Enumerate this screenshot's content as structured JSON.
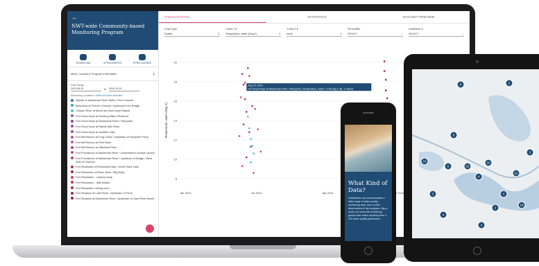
{
  "sidebar": {
    "back": "←",
    "title": "NWT-wide Community-based Monitoring Program",
    "tools": [
      {
        "label": "DOWNLOAD",
        "icon": "cloud-download-icon"
      },
      {
        "label": "ATTACHMENTS",
        "icon": "paperclip-icon"
      },
      {
        "label": "OPEN LICENSE",
        "icon": "license-icon"
      }
    ],
    "meta_label": "Meta, Contact & Program Information",
    "date_range_label": "Date Range",
    "date_from": "2012-08-31",
    "date_sep": "to",
    "date_to": "2019-10-10",
    "locations_label": "Monitoring Locations",
    "select_all": "Select all",
    "clear_selection": "Clear selection",
    "locations": [
      {
        "label": "Aklavik at Mackenzie River Delta / Peel Channel",
        "color": "#3a6fb0"
      },
      {
        "label": "Behchoko at Frank's Channel / Upstream from Bridge",
        "color": "#2aa8b8"
      },
      {
        "label": "Canyon River at Mouth by Sans Sault Rapids",
        "color": "#4cc0c0"
      },
      {
        "label": "Fort Good Hope at Drinking Water Reservoir",
        "color": "#7a5bb0"
      },
      {
        "label": "Fort Good Hope at Mackenzie River / Ramparts",
        "color": "#9a2f8f"
      },
      {
        "label": "Fort Good Hope at Rabbit Skin River",
        "color": "#b03a9a"
      },
      {
        "label": "Fort Good Hope at Jackfish Lake",
        "color": "#8a4fb5"
      },
      {
        "label": "Fort McPherson at Frog Creek / Upstream of Dempster Ferry",
        "color": "#c2459b"
      },
      {
        "label": "Fort McPherson at Peel River",
        "color": "#d14c95"
      },
      {
        "label": "Fort McPherson at Vittrekwa River",
        "color": "#c0398a"
      },
      {
        "label": "Fort Providence at Mackenzie River / Downstream of Boat Launch",
        "color": "#d6446b"
      },
      {
        "label": "Fort Providence at Mackenzie River / Upstream of Bridge / West Side of Channel",
        "color": "#c73363"
      },
      {
        "label": "Fort Resolution at Resolution Bay / Great Slave Lake",
        "color": "#b82456"
      },
      {
        "label": "Fort Resolution at Slave River / Big Eddy",
        "color": "#a81f4a"
      },
      {
        "label": "Fort Resolution - cultural camp",
        "color": "#d13c55"
      },
      {
        "label": "Fort Resolution - little buffalo",
        "color": "#c8304a"
      },
      {
        "label": "Fort Resolution mining zone",
        "color": "#b52a42"
      },
      {
        "label": "Fort Simpson at Liard River / Upstream of Ferry",
        "color": "#a3213a"
      },
      {
        "label": "Fort Simpson at Mackenzie River / Upstream of Liard River Mouth",
        "color": "#931b33"
      }
    ]
  },
  "tabs": [
    "VISUALIZATION",
    "STATISTICS",
    "DATASET PREVIEW"
  ],
  "controls": [
    {
      "label": "Chart Type",
      "value": "Scatter",
      "suffix": "⇕"
    },
    {
      "label": "Y-Axis 1 ●",
      "value": "Temperature, water (Deg C)",
      "suffix": "⇕"
    },
    {
      "label": "Y-Axis 2 ●",
      "value": "None",
      "suffix": "⇕"
    },
    {
      "label": "Percentiles",
      "value": "SELECT",
      "suffix": "⌄"
    },
    {
      "label": "Guidelines ●",
      "value": "SELECT",
      "suffix": "⌄"
    }
  ],
  "chart_data": {
    "type": "scatter",
    "ylabel": "Temperature, water (Deg C)",
    "yticks": [
      8,
      10,
      12,
      14,
      16,
      18,
      20
    ],
    "ylim": [
      7,
      21
    ],
    "xticks": [
      "Jan 2013",
      "Jul 2013",
      "Jan 2014",
      "Jul 2014"
    ],
    "tooltip": "Aug 23, 2013\nFort Good Hope at Mackenzie River / Ramparts | Temperature, water: 17.65 deg C @ -1 metres",
    "series": [
      {
        "color": "#8e2f9c",
        "values": [
          {
            "x": 0.45,
            "y": 17.7
          },
          {
            "x": 0.46,
            "y": 16.2
          },
          {
            "x": 0.47,
            "y": 14.9
          },
          {
            "x": 0.48,
            "y": 19.4
          },
          {
            "x": 0.49,
            "y": 12.8
          },
          {
            "x": 0.5,
            "y": 11.3
          },
          {
            "x": 0.44,
            "y": 18.8
          },
          {
            "x": 0.51,
            "y": 15.5
          },
          {
            "x": 0.47,
            "y": 10.2
          },
          {
            "x": 0.45,
            "y": 13.6
          }
        ]
      },
      {
        "color": "#4cc0c0",
        "values": [
          {
            "x": 0.49,
            "y": 13.2
          },
          {
            "x": 0.5,
            "y": 12.1
          },
          {
            "x": 0.51,
            "y": 11.4
          },
          {
            "x": 0.48,
            "y": 14.4
          },
          {
            "x": 0.52,
            "y": 10.6
          },
          {
            "x": 0.5,
            "y": 9.7
          }
        ]
      },
      {
        "color": "#d6446b",
        "values": [
          {
            "x": 0.43,
            "y": 16.4
          },
          {
            "x": 0.46,
            "y": 17.9
          },
          {
            "x": 0.49,
            "y": 18.6
          },
          {
            "x": 0.53,
            "y": 15.2
          },
          {
            "x": 0.55,
            "y": 13.1
          },
          {
            "x": 0.42,
            "y": 12.4
          },
          {
            "x": 0.57,
            "y": 10.8
          },
          {
            "x": 0.44,
            "y": 9.3
          },
          {
            "x": 0.52,
            "y": 8.6
          }
        ]
      },
      {
        "color": "#a81f3c",
        "values": [
          {
            "x": 1.44,
            "y": 20.1
          },
          {
            "x": 1.44,
            "y": 19.1
          },
          {
            "x": 1.45,
            "y": 18.2
          },
          {
            "x": 1.45,
            "y": 17.1
          },
          {
            "x": 1.46,
            "y": 16.3
          },
          {
            "x": 1.44,
            "y": 15.2
          },
          {
            "x": 1.45,
            "y": 14.1
          },
          {
            "x": 1.46,
            "y": 13.2
          },
          {
            "x": 1.44,
            "y": 12.1
          },
          {
            "x": 1.45,
            "y": 11.3
          },
          {
            "x": 1.46,
            "y": 10.2
          },
          {
            "x": 1.45,
            "y": 9.3
          },
          {
            "x": 1.44,
            "y": 8.4
          }
        ]
      },
      {
        "color": "#c2459b",
        "values": [
          {
            "x": 1.86,
            "y": 19.6
          },
          {
            "x": 1.87,
            "y": 18.4
          },
          {
            "x": 1.86,
            "y": 17.2
          },
          {
            "x": 1.88,
            "y": 16.1
          },
          {
            "x": 1.87,
            "y": 15.1
          }
        ]
      }
    ]
  },
  "phone": {
    "title": "What Kind of Data?",
    "text": "DataStream can accommodate a wide range of water quality monitoring data, from in-field observations to lab analyses. Big or small, we work with monitoring groups that collect anything from 2-200 water quality parameters."
  },
  "tablet": {
    "cluster_labels": [
      "6",
      "2",
      "15",
      "5",
      "16",
      "10",
      "4",
      "12",
      "4",
      "18",
      "2",
      "3",
      "6",
      "4",
      "3",
      "3"
    ]
  }
}
